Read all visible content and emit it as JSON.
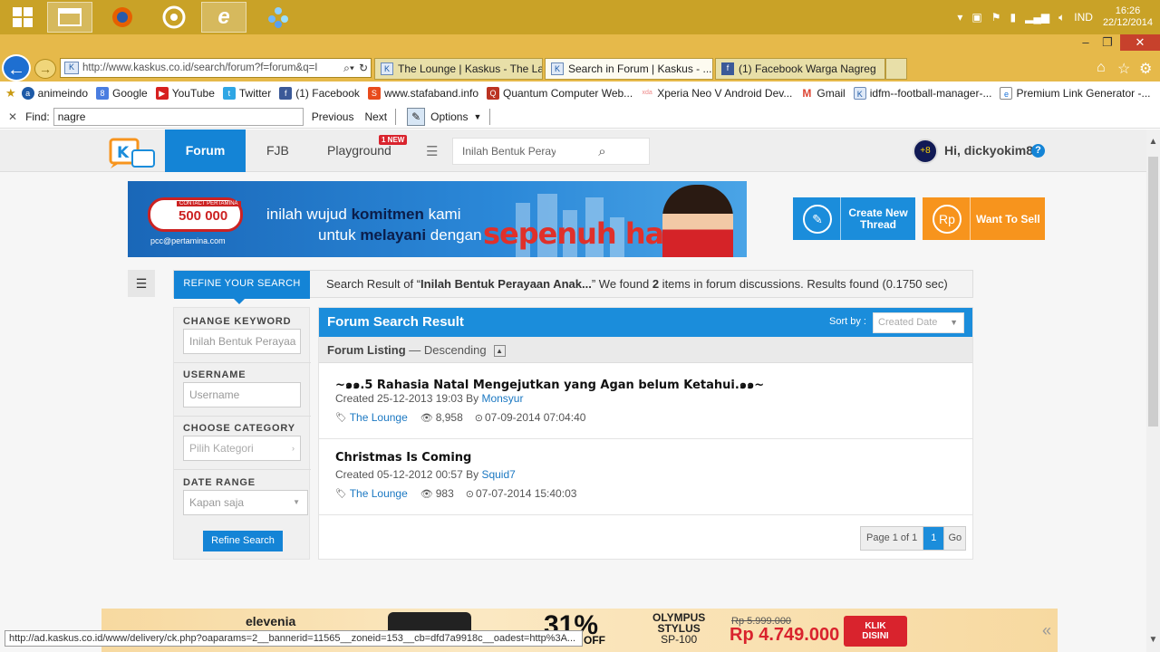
{
  "taskbar": {
    "tray_language": "IND",
    "clock_time": "16:26",
    "clock_date": "22/12/2014"
  },
  "browser": {
    "address": "http://www.kaskus.co.id/search/forum?f=forum&q=I",
    "address_domain": "kaskus.co.id",
    "tabs": [
      {
        "label": "The Lounge | Kaskus - The Lar..."
      },
      {
        "label": "Search in Forum | Kaskus - ..."
      },
      {
        "label": "(1) Facebook Warga Nagreg"
      }
    ],
    "favorites": [
      {
        "label": "animeindo"
      },
      {
        "label": "Google"
      },
      {
        "label": "YouTube"
      },
      {
        "label": "Twitter"
      },
      {
        "label": "(1) Facebook"
      },
      {
        "label": "www.stafaband.info"
      },
      {
        "label": "Quantum Computer Web..."
      },
      {
        "label": "Xperia Neo V Android Dev..."
      },
      {
        "label": "Gmail"
      },
      {
        "label": "idfm--football-manager-..."
      },
      {
        "label": "Premium Link Generator -..."
      }
    ],
    "find": {
      "label": "Find:",
      "value": "nagre",
      "prev": "Previous",
      "next": "Next",
      "options": "Options"
    },
    "status_url": "http://ad.kaskus.co.id/www/delivery/ck.php?oaparams=2__bannerid=11565__zoneid=153__cb=dfd7a9918c__oadest=http%3A..."
  },
  "header": {
    "nav_forum": "Forum",
    "nav_fjb": "FJB",
    "nav_playground": "Playground",
    "new_badge": "1 NEW",
    "search_value": "Inilah Bentuk Perayaan Anak-an",
    "greeting": "Hi, dickyokim8",
    "help": "?"
  },
  "banner": {
    "contact_label": "CONTACT PERTAMINA",
    "contact_number": "500 000",
    "email": "pcc@pertamina.com",
    "line1_a": "inilah wujud ",
    "line1_b": "komitmen",
    "line1_c": " kami",
    "line2_a": "untuk ",
    "line2_b": "melayani",
    "line2_c": " dengan",
    "slogan": "sepenuh hati"
  },
  "actions": {
    "create_line1": "Create New",
    "create_line2": "Thread",
    "sell": "Want To Sell",
    "sell_icon": "Rp"
  },
  "resultbar": {
    "refine_tab": "REFINE YOUR SEARCH",
    "prefix": "Search Result of “",
    "query": "Inilah Bentuk Perayaan Anak...",
    "middle": "” We found ",
    "count": "2",
    "suffix": " items in forum discussions. Results found (0.1750 sec)"
  },
  "sidebar": {
    "keyword_title": "CHANGE KEYWORD",
    "keyword_value": "Inilah Bentuk Perayaa",
    "username_title": "USERNAME",
    "username_placeholder": "Username",
    "category_title": "CHOOSE CATEGORY",
    "category_placeholder": "Pilih Kategori",
    "date_title": "DATE RANGE",
    "date_value": "Kapan saja",
    "refine_button": "Refine Search"
  },
  "results": {
    "title": "Forum Search Result",
    "sort_label": "Sort by :",
    "sort_value": "Created Date",
    "listing_label": "Forum Listing",
    "listing_order": " — Descending",
    "items": [
      {
        "title": "~๑๑.5 Rahasia Natal Mengejutkan yang Agan belum Ketahui.๑๑~",
        "created": "Created 25-12-2013 19:03 By ",
        "author": "Monsyur",
        "category": "The Lounge",
        "views": "8,958",
        "last": "07-09-2014 07:04:40"
      },
      {
        "title": "Christmas Is Coming",
        "created": "Created 05-12-2012 00:57 By ",
        "author": "Squid7",
        "category": "The Lounge",
        "views": "983",
        "last": "07-07-2014 15:40:03"
      }
    ],
    "pager_info": "Page 1 of 1",
    "pager_current": "1",
    "pager_go": "Go"
  },
  "ad": {
    "brand": "elevenia",
    "discount": "31%",
    "off": "OFF",
    "product_line1": "OLYMPUS",
    "product_line2": "STYLUS",
    "product_line3": "SP-100",
    "old_price": "Rp 5.999.000",
    "new_price": "Rp 4.749.000",
    "cta_line1": "KLIK",
    "cta_line2": "DISINI"
  }
}
